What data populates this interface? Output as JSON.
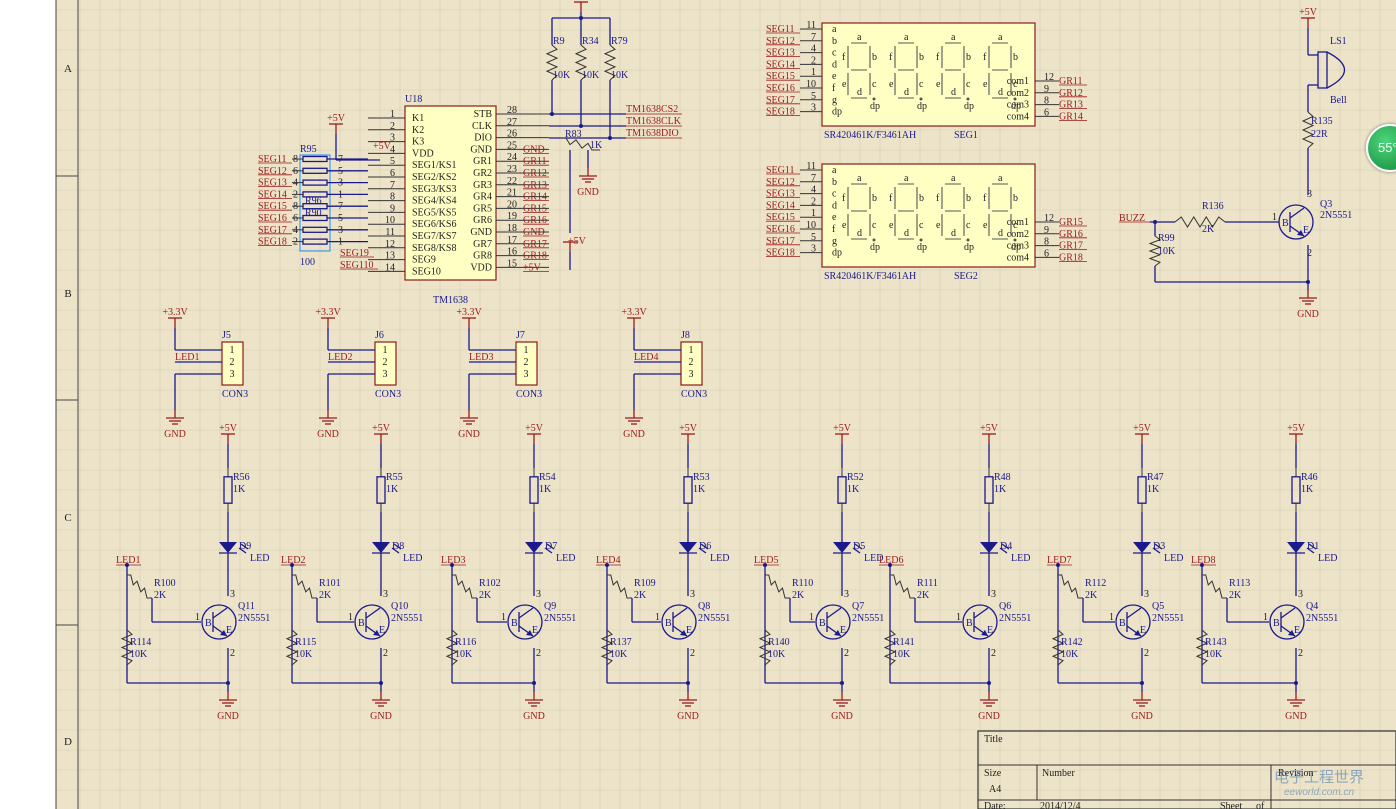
{
  "colors": {
    "sheet": "#ece3c8",
    "grid": "#d6cdb3",
    "wire": "#1a1a8c",
    "power": "#9b1b1b",
    "ic_fill": "#ffffc4"
  },
  "zones": {
    "rows": [
      "A",
      "B",
      "C",
      "D"
    ]
  },
  "u18": {
    "designator": "U18",
    "part": "TM1638",
    "left_pins": [
      {
        "num": "1",
        "name": "K1"
      },
      {
        "num": "2",
        "name": "K2"
      },
      {
        "num": "3",
        "name": "K3"
      },
      {
        "num": "4",
        "name": "VDD"
      },
      {
        "num": "5",
        "name": "SEG1/KS1"
      },
      {
        "num": "6",
        "name": "SEG2/KS2"
      },
      {
        "num": "7",
        "name": "SEG3/KS3"
      },
      {
        "num": "8",
        "name": "SEG4/KS4"
      },
      {
        "num": "9",
        "name": "SEG5/KS5"
      },
      {
        "num": "10",
        "name": "SEG6/KS6"
      },
      {
        "num": "11",
        "name": "SEG7/KS7"
      },
      {
        "num": "12",
        "name": "SEG8/KS8"
      },
      {
        "num": "13",
        "name": "SEG9"
      },
      {
        "num": "14",
        "name": "SEG10"
      }
    ],
    "right_pins": [
      {
        "num": "28",
        "name": "STB",
        "net": ""
      },
      {
        "num": "27",
        "name": "CLK",
        "net": ""
      },
      {
        "num": "26",
        "name": "DIO",
        "net": ""
      },
      {
        "num": "25",
        "name": "GND",
        "net": "GND"
      },
      {
        "num": "24",
        "name": "GR1",
        "net": "GR11"
      },
      {
        "num": "23",
        "name": "GR2",
        "net": "GR12"
      },
      {
        "num": "22",
        "name": "GR3",
        "net": "GR13"
      },
      {
        "num": "21",
        "name": "GR4",
        "net": "GR14"
      },
      {
        "num": "20",
        "name": "GR5",
        "net": "GR15"
      },
      {
        "num": "19",
        "name": "GR6",
        "net": "GR16"
      },
      {
        "num": "18",
        "name": "GND",
        "net": "GND"
      },
      {
        "num": "17",
        "name": "GR7",
        "net": "GR17"
      },
      {
        "num": "16",
        "name": "GR8",
        "net": "GR18"
      },
      {
        "num": "15",
        "name": "VDD",
        "net": "+5V"
      }
    ],
    "vdd_label": "+5V",
    "seg_nets_left": [
      "SEG11",
      "SEG12",
      "SEG13",
      "SEG14",
      "SEG15",
      "SEG16",
      "SEG17",
      "SEG18"
    ],
    "seg_extra": [
      "SEG19",
      "SEG110"
    ],
    "pullups": [
      "R9",
      "R34",
      "R79"
    ],
    "pullup_value": "10K",
    "top_supply": "+5V",
    "ctrl_nets": [
      "TM1638CS2",
      "TM1638CLK",
      "TM1638DIO"
    ],
    "r83": {
      "ref": "R83",
      "value": "1K"
    },
    "gnd_label": "GND",
    "pwr_label": "+5V"
  },
  "r95": {
    "ref": "R95",
    "mid_refs": [
      "R96",
      "R90"
    ],
    "value": "100",
    "rows": [
      {
        "left": "8",
        "right": "7"
      },
      {
        "left": "6",
        "right": "5"
      },
      {
        "left": "4",
        "right": "3"
      },
      {
        "left": "2",
        "right": "1"
      },
      {
        "left": "8",
        "right": "7"
      },
      {
        "left": "6",
        "right": "5"
      },
      {
        "left": "4",
        "right": "3"
      },
      {
        "left": "2",
        "right": "1"
      }
    ]
  },
  "displays": [
    {
      "nets": [
        "SEG11",
        "SEG12",
        "SEG13",
        "SEG14",
        "SEG15",
        "SEG16",
        "SEG17",
        "SEG18"
      ],
      "pin_nums": [
        "11",
        "7",
        "4",
        "2",
        "1",
        "10",
        "5",
        "3"
      ],
      "letters": [
        "a",
        "b",
        "c",
        "d",
        "e",
        "f",
        "g",
        "dp"
      ],
      "com_labels": [
        "com1",
        "com2",
        "com3",
        "com4"
      ],
      "com_pins": [
        "12",
        "9",
        "8",
        "6"
      ],
      "gr_nets": [
        "GR11",
        "GR12",
        "GR13",
        "GR14"
      ],
      "part": "SR420461K/F3461AH",
      "ref": "SEG1"
    },
    {
      "nets": [
        "SEG11",
        "SEG12",
        "SEG13",
        "SEG14",
        "SEG15",
        "SEG16",
        "SEG17",
        "SEG18"
      ],
      "pin_nums": [
        "11",
        "7",
        "4",
        "2",
        "1",
        "10",
        "5",
        "3"
      ],
      "letters": [
        "a",
        "b",
        "c",
        "d",
        "e",
        "f",
        "g",
        "dp"
      ],
      "com_labels": [
        "com1",
        "com2",
        "com3",
        "com4"
      ],
      "com_pins": [
        "12",
        "9",
        "8",
        "6"
      ],
      "gr_nets": [
        "GR15",
        "GR16",
        "GR17",
        "GR18"
      ],
      "part": "SR420461K/F3461AH",
      "ref": "SEG2"
    }
  ],
  "digit_labels": [
    "f",
    "a",
    "b",
    "e",
    "d",
    "c",
    "dp"
  ],
  "buzzer": {
    "supply": "+5V",
    "ref": "LS1",
    "part": "Bell",
    "rb": {
      "ref": "R135",
      "value": "22R"
    },
    "rin": {
      "ref": "R136",
      "value": "2K"
    },
    "rpd": {
      "ref": "R99",
      "value": "10K"
    },
    "q": {
      "ref": "Q3",
      "part": "2N5551"
    },
    "net": "BUZZ",
    "gnd": "GND",
    "pins": [
      "1",
      "2",
      "3"
    ]
  },
  "connectors": [
    {
      "ref": "J5",
      "part": "CON3",
      "supply": "+3.3V",
      "net": "LED1",
      "gnd": "GND",
      "pins": [
        "1",
        "2",
        "3"
      ]
    },
    {
      "ref": "J6",
      "part": "CON3",
      "supply": "+3.3V",
      "net": "LED2",
      "gnd": "GND",
      "pins": [
        "1",
        "2",
        "3"
      ]
    },
    {
      "ref": "J7",
      "part": "CON3",
      "supply": "+3.3V",
      "net": "LED3",
      "gnd": "GND",
      "pins": [
        "1",
        "2",
        "3"
      ]
    },
    {
      "ref": "J8",
      "part": "CON3",
      "supply": "+3.3V",
      "net": "LED4",
      "gnd": "GND",
      "pins": [
        "1",
        "2",
        "3"
      ]
    }
  ],
  "drivers": [
    {
      "supply": "+5V",
      "r_ref": "R56",
      "r_val": "1K",
      "d_ref": "D9",
      "d_part": "LED",
      "net": "LED1",
      "rb_ref": "R100",
      "rb_val": "2K",
      "rp_ref": "R114",
      "rp_val": "10K",
      "q_ref": "Q11",
      "q_part": "2N5551",
      "gnd": "GND"
    },
    {
      "supply": "+5V",
      "r_ref": "R55",
      "r_val": "1K",
      "d_ref": "D8",
      "d_part": "LED",
      "net": "LED2",
      "rb_ref": "R101",
      "rb_val": "2K",
      "rp_ref": "R115",
      "rp_val": "10K",
      "q_ref": "Q10",
      "q_part": "2N5551",
      "gnd": "GND"
    },
    {
      "supply": "+5V",
      "r_ref": "R54",
      "r_val": "1K",
      "d_ref": "D7",
      "d_part": "LED",
      "net": "LED3",
      "rb_ref": "R102",
      "rb_val": "2K",
      "rp_ref": "R116",
      "rp_val": "10K",
      "q_ref": "Q9",
      "q_part": "2N5551",
      "gnd": "GND"
    },
    {
      "supply": "+5V",
      "r_ref": "R53",
      "r_val": "1K",
      "d_ref": "D6",
      "d_part": "LED",
      "net": "LED4",
      "rb_ref": "R109",
      "rb_val": "2K",
      "rp_ref": "R137",
      "rp_val": "10K",
      "q_ref": "Q8",
      "q_part": "2N5551",
      "gnd": "GND"
    },
    {
      "supply": "+5V",
      "r_ref": "R52",
      "r_val": "1K",
      "d_ref": "D5",
      "d_part": "LED",
      "net": "LED5",
      "rb_ref": "R110",
      "rb_val": "2K",
      "rp_ref": "R140",
      "rp_val": "10K",
      "q_ref": "Q7",
      "q_part": "2N5551",
      "gnd": "GND"
    },
    {
      "supply": "+5V",
      "r_ref": "R48",
      "r_val": "1K",
      "d_ref": "D4",
      "d_part": "LED",
      "net": "LED6",
      "rb_ref": "R111",
      "rb_val": "2K",
      "rp_ref": "R141",
      "rp_val": "10K",
      "q_ref": "Q6",
      "q_part": "2N5551",
      "gnd": "GND"
    },
    {
      "supply": "+5V",
      "r_ref": "R47",
      "r_val": "1K",
      "d_ref": "D3",
      "d_part": "LED",
      "net": "LED7",
      "rb_ref": "R112",
      "rb_val": "2K",
      "rp_ref": "R142",
      "rp_val": "10K",
      "q_ref": "Q5",
      "q_part": "2N5551",
      "gnd": "GND"
    },
    {
      "supply": "+5V",
      "r_ref": "R46",
      "r_val": "1K",
      "d_ref": "D1",
      "d_part": "LED",
      "net": "LED8",
      "rb_ref": "R113",
      "rb_val": "2K",
      "rp_ref": "R143",
      "rp_val": "10K",
      "q_ref": "Q4",
      "q_part": "2N5551",
      "gnd": "GND"
    }
  ],
  "driver_pins": [
    "1",
    "2",
    "3"
  ],
  "title_block": {
    "title_label": "Title",
    "size_label": "Size",
    "size_value": "A4",
    "number_label": "Number",
    "revision_label": "Revision",
    "date_label": "Date:",
    "date_value": "2014/12/4",
    "sheet_label": "Sheet",
    "of_label": "of"
  },
  "zoom_badge": "55°",
  "watermark": {
    "cn": "电子工程世界",
    "en": "eeworld.com.cn"
  }
}
